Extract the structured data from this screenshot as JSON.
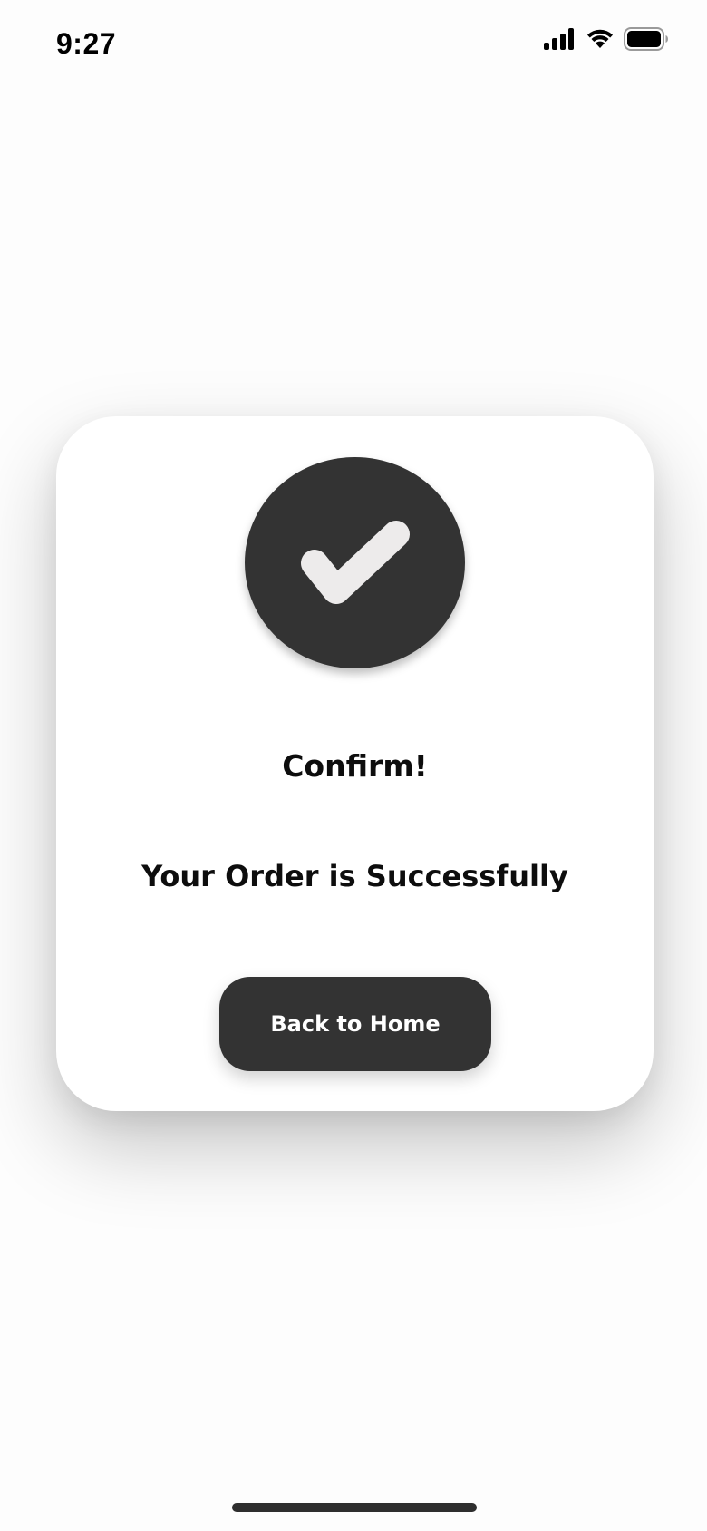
{
  "status_bar": {
    "time": "9:27",
    "icons": [
      "cellular-signal-icon",
      "wifi-icon",
      "battery-icon"
    ]
  },
  "dialog": {
    "icon": "checkmark-icon",
    "title": "Confirm!",
    "message": "Your Order is Successfully",
    "button_label": "Back to Home"
  },
  "colors": {
    "primary_dark": "#333333",
    "check_mark": "#EDEBEB",
    "card_background": "#FFFFFF",
    "page_background": "#FDFDFD"
  }
}
